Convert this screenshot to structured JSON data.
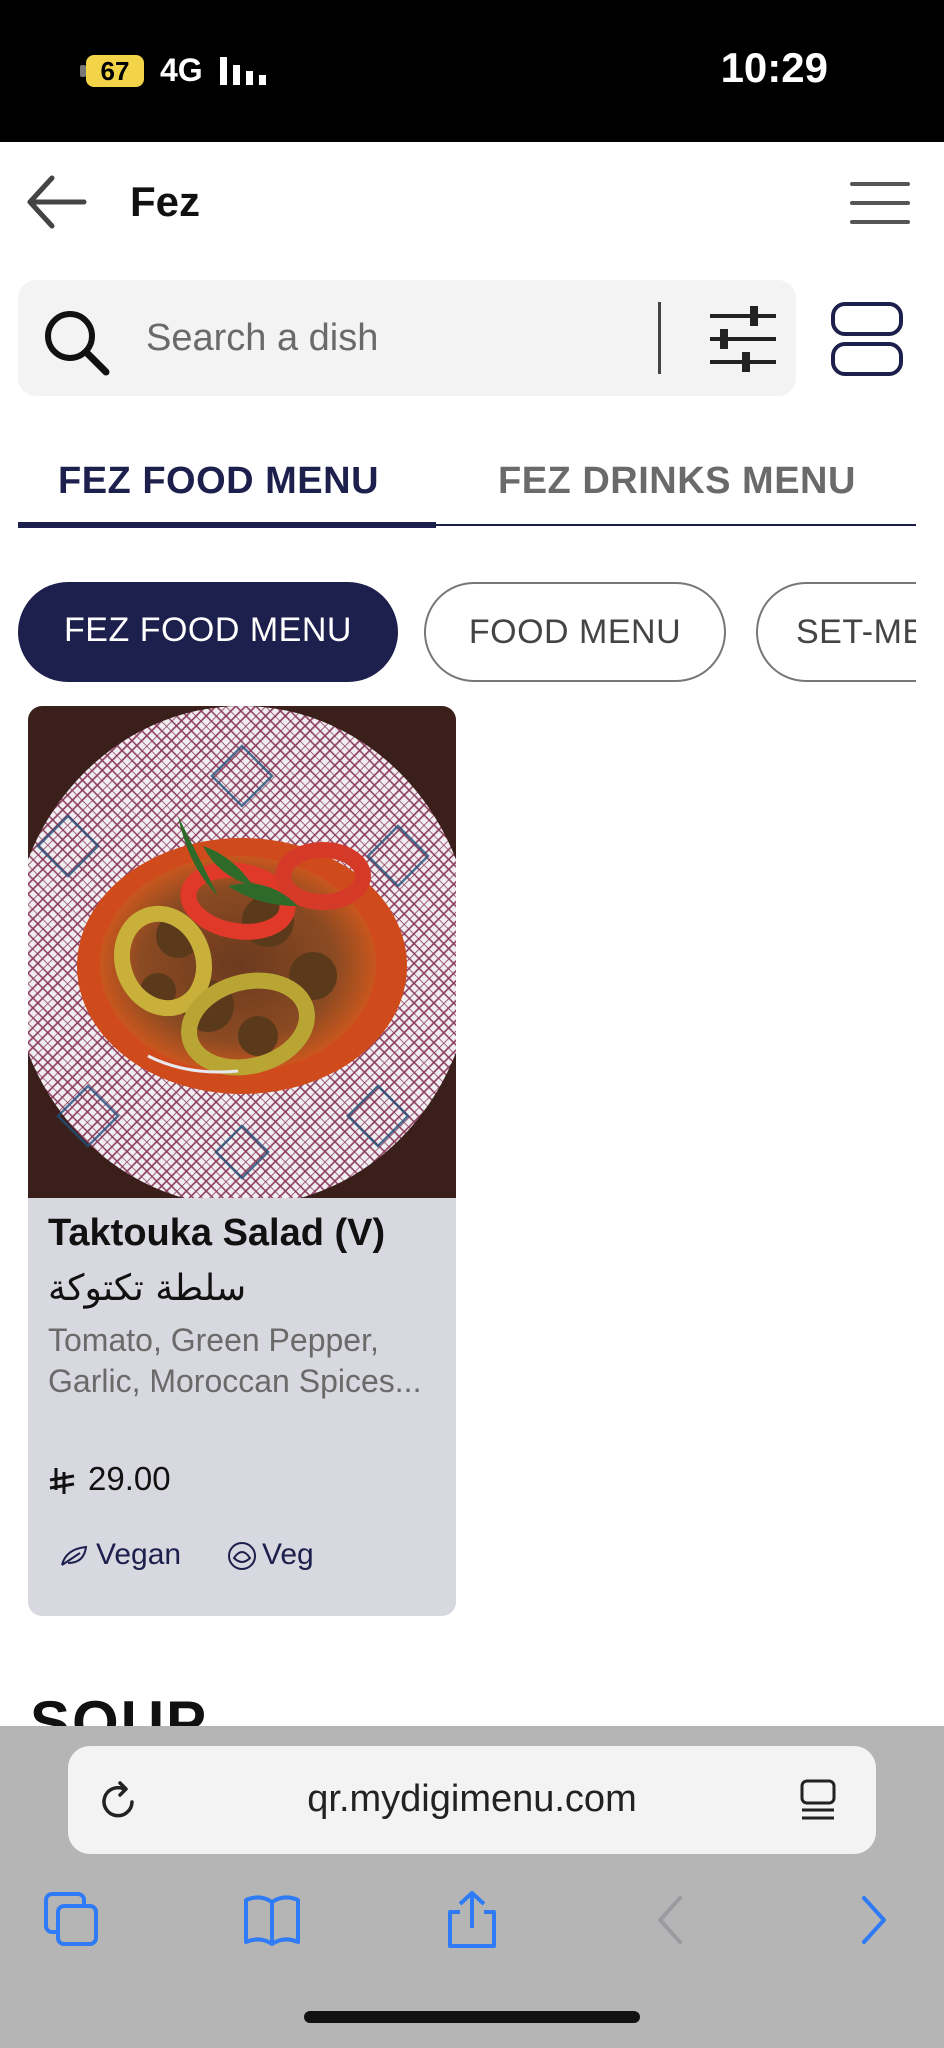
{
  "status_bar": {
    "battery": "67",
    "network": "4G",
    "time": "10:29"
  },
  "header": {
    "title": "Fez",
    "back_icon": "arrow-left-icon",
    "menu_icon": "hamburger-icon"
  },
  "search": {
    "placeholder": "Search a dish",
    "search_icon": "search-icon",
    "filter_icon": "sliders-icon",
    "layout_icon": "list-view-icon"
  },
  "tabs": [
    {
      "label": "FEZ FOOD MENU",
      "active": true
    },
    {
      "label": "FEZ DRINKS MENU",
      "active": false
    }
  ],
  "categories": [
    {
      "label": "FEZ FOOD MENU",
      "active": true
    },
    {
      "label": "FOOD MENU",
      "active": false
    },
    {
      "label": "SET-ME",
      "active": false
    }
  ],
  "dish": {
    "name": "Taktouka Salad (V)",
    "arabic_name": "سلطة تكتوكة",
    "description": "Tomato, Green Pepper, Garlic, Moroccan Spices...",
    "price": "29.00",
    "currency_icon": "saudi-riyal-icon",
    "tags": [
      {
        "label": "Vegan",
        "icon": "leaf-icon"
      },
      {
        "label": "Veg",
        "icon": "veg-icon"
      }
    ]
  },
  "section": {
    "heading": "SOUP"
  },
  "browser": {
    "url": "qr.mydigimenu.com",
    "reload_icon": "reload-icon",
    "reader_icon": "reader-icon",
    "toolbar_icons": [
      "tabs-icon",
      "bookmarks-icon",
      "share-icon",
      "back-icon",
      "forward-icon"
    ]
  },
  "colors": {
    "brand_navy": "#1d1f4d",
    "card_bg": "#d8d8e0",
    "browser_blue": "#2f7bf6"
  }
}
